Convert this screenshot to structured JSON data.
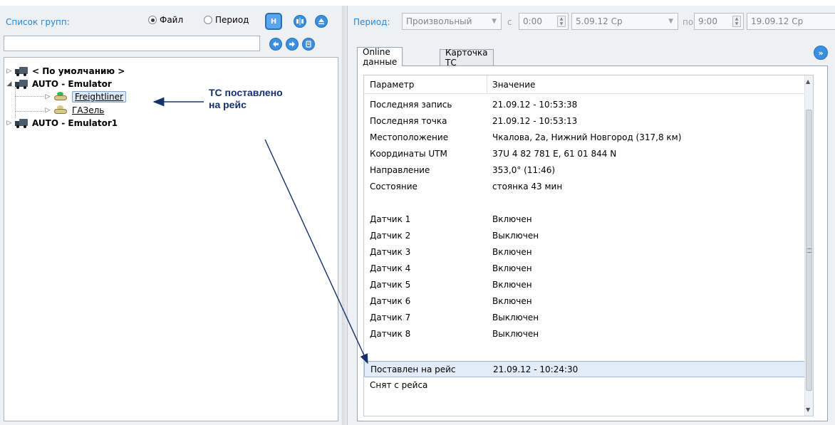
{
  "left": {
    "groups_label": "Список групп:",
    "radio_file": "Файл",
    "radio_period": "Период",
    "filter_value": "",
    "tree": [
      {
        "label": "< По умолчанию >",
        "bold": true
      },
      {
        "label": "AUTO - Emulator",
        "bold": true
      },
      {
        "label": "Freightliner",
        "link": true,
        "selected": true
      },
      {
        "label": "ГАЗель",
        "link": true
      },
      {
        "label": "AUTO - Emulator1",
        "bold": true
      }
    ]
  },
  "annotation": {
    "line1": "ТС поставлено",
    "line2": "на рейс"
  },
  "right": {
    "period_label": "Период:",
    "period_value": "Произвольный",
    "from_label": "с",
    "time_from": "0:00",
    "date_from": "5.09.12 Ср",
    "to_label": "по",
    "time_to": "9:00",
    "date_to": "19.09.12 Ср",
    "tabs": [
      "Online данные",
      "Карточка ТС"
    ],
    "grid": {
      "col_param": "Параметр",
      "col_value": "Значение",
      "rows": [
        {
          "p": "Последняя запись",
          "v": "21.09.12 - 10:53:38"
        },
        {
          "p": "Последняя точка",
          "v": "21.09.12 - 10:53:13"
        },
        {
          "p": "Местоположение",
          "v": "Чкалова, 2а, Нижний Новгород (317,8 км)"
        },
        {
          "p": "Координаты UTM",
          "v": "37U 4 82 781 E, 61 01 844 N"
        },
        {
          "p": "Направление",
          "v": "353,0° (11:46)"
        },
        {
          "p": "Состояние",
          "v": "стоянка 43 мин"
        },
        {
          "p": "",
          "v": ""
        },
        {
          "p": "Датчик 1",
          "v": "Включен"
        },
        {
          "p": "Датчик 2",
          "v": "Выключен"
        },
        {
          "p": "Датчик 3",
          "v": "Включен"
        },
        {
          "p": "Датчик 4",
          "v": "Включен"
        },
        {
          "p": "Датчик 5",
          "v": "Включен"
        },
        {
          "p": "Датчик 6",
          "v": "Включен"
        },
        {
          "p": "Датчик 7",
          "v": "Выключен"
        },
        {
          "p": "Датчик 8",
          "v": "Выключен"
        },
        {
          "p": "",
          "v": ""
        },
        {
          "p": "Поставлен на рейс",
          "v": "21.09.12 - 10:24:30",
          "highlight": true
        },
        {
          "p": "Снят с рейса",
          "v": ""
        }
      ]
    }
  },
  "colors": {
    "accent": "#3a8fe0",
    "annotation": "#14306e",
    "highlight": "#e2ecf8"
  },
  "icons": {
    "h_button": "H",
    "split_button": "split-icon",
    "eject_button": "eject-icon",
    "back_button": "arrow-left-icon",
    "forward_button": "arrow-right-icon",
    "list_button": "list-icon",
    "tabs_nav": "double-chevron-right-icon"
  }
}
